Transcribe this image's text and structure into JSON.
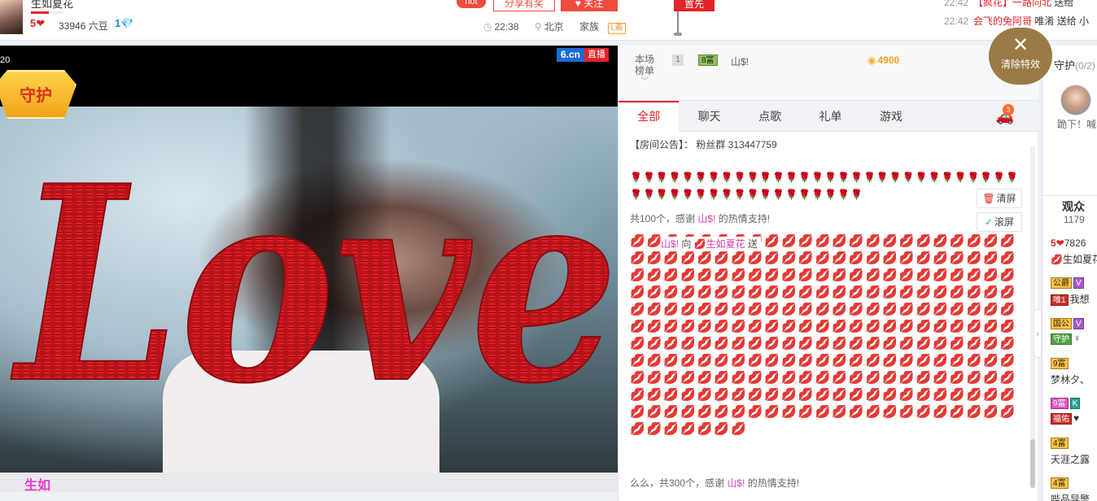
{
  "header": {
    "anchor_name": "生如夏花",
    "level_progress": 0.55,
    "rich_level": "5",
    "beans_text": "33946 六豆",
    "diamond_level": "1",
    "hot_tag": "hot",
    "share_label": "分享有奖",
    "follow_label": "关注",
    "time": "22:38",
    "location": "北京",
    "family_label": "家族",
    "family_badge": "L義",
    "pin_label": "置先",
    "top_messages": [
      {
        "time": "22:42",
        "user": "【疯花】一路向北",
        "action": "送给"
      },
      {
        "time": "22:42",
        "user": "会飞的兔阿哥",
        "action": "唯淆 送给 小"
      }
    ]
  },
  "video": {
    "counter": "20",
    "guard_badge": "守护",
    "site_label": "6.cn",
    "live_label": "直播",
    "effect_text": "Love",
    "bottom_text": "生如"
  },
  "chat": {
    "rank_label_1": "本场",
    "rank_label_2": "榜单",
    "rank_no": "1",
    "rank_badge": "8富",
    "rank_user": "山$!",
    "rank_coins": "4900",
    "tabs": [
      "全部",
      "聊天",
      "点歌",
      "礼单",
      "游戏"
    ],
    "car_badge": "3",
    "notice": "【房间公告】： 粉丝群 313447759",
    "thanks_1_prefix": "共100个，感谢 ",
    "thanks_1_user": "山$!",
    "thanks_1_suffix": " 的热情支持!",
    "send_user": "山$!",
    "send_mid": " 向 ",
    "send_target": "生如夏花",
    "send_action": " 送",
    "thanks_2_prefix": "么么，共300个，感谢 ",
    "thanks_2_user": "山$!",
    "thanks_2_suffix": " 的热情支持!",
    "clear_label": "清屏",
    "scroll_label": "滚屏",
    "clear_fx_label": "清除特效"
  },
  "rightcol": {
    "guard_title": "守护",
    "guard_count": "(0/2)",
    "guard_msg": "跪下！喊",
    "audience_title": "观众",
    "audience_count": "1179",
    "audience": [
      {
        "badge": "5",
        "name": "7826"
      },
      {
        "badge": "",
        "name": "生如夏花"
      },
      {
        "badge": "公爵",
        "name": "我想"
      },
      {
        "badge": "唯1",
        "name": ""
      },
      {
        "badge": "国公",
        "name": "守护"
      },
      {
        "badge": "9富",
        "name": "梦林夕、"
      },
      {
        "badge": "9富",
        "name": "福佑"
      },
      {
        "badge": "4富",
        "name": "天涯之露"
      },
      {
        "badge": "4富",
        "name": "哔品导警"
      }
    ]
  },
  "colors": {
    "brand_red": "#e2232a",
    "accent_gold": "#9b7a45",
    "link_purple": "#d040b0",
    "site_blue": "#1d6bd6"
  }
}
